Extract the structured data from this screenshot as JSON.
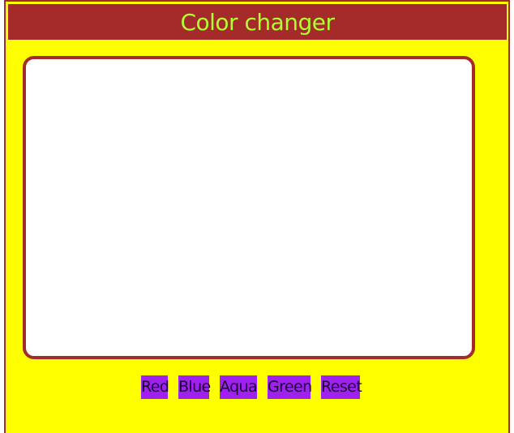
{
  "header": {
    "title": "Color changer"
  },
  "colors": {
    "background": "#ffff00",
    "header_bg": "#a52a2a",
    "title_color": "#adff2f",
    "box_border": "#a52a2a",
    "box_fill": "#ffffff",
    "button_bg": "#a020f0"
  },
  "buttons": [
    {
      "label": "Red"
    },
    {
      "label": "Blue"
    },
    {
      "label": "Aqua"
    },
    {
      "label": "Green"
    },
    {
      "label": "Reset"
    }
  ]
}
